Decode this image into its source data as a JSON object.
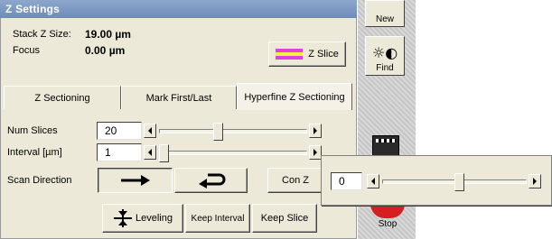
{
  "window": {
    "title": "Z Settings"
  },
  "info": {
    "stack_label": "Stack Z Size:",
    "stack_value": "19.00 µm",
    "focus_label": "Focus",
    "focus_value": "0.00 µm"
  },
  "zslice_button": {
    "label": "Z Slice"
  },
  "tabs": [
    {
      "label": "Z Sectioning"
    },
    {
      "label": "Mark First/Last"
    },
    {
      "label": "Hyperfine Z Sectioning",
      "active": true
    }
  ],
  "num_slices": {
    "label": "Num Slices",
    "value": "20",
    "slider_fraction": 0.5
  },
  "interval": {
    "label": "Interval [µm]",
    "value": "1",
    "slider_fraction": 0.02
  },
  "scan_direction": {
    "label": "Scan Direction",
    "forward_icon": "right-arrow-icon",
    "return_icon": "return-arrow-icon"
  },
  "con_z": {
    "label": "Con Z"
  },
  "bottom_buttons": {
    "leveling": "Leveling",
    "keep_interval": "Keep Interval",
    "keep_slice": "Keep Slice"
  },
  "toolbar": {
    "new_label": "New",
    "find_label": "Find",
    "stop_label": "Stop"
  },
  "popup": {
    "value": "0",
    "slider_fraction": 0.57
  },
  "colors": {
    "title_bar": "#7a96c2",
    "panel": "#ece9d8",
    "stop_red": "#d42020"
  }
}
